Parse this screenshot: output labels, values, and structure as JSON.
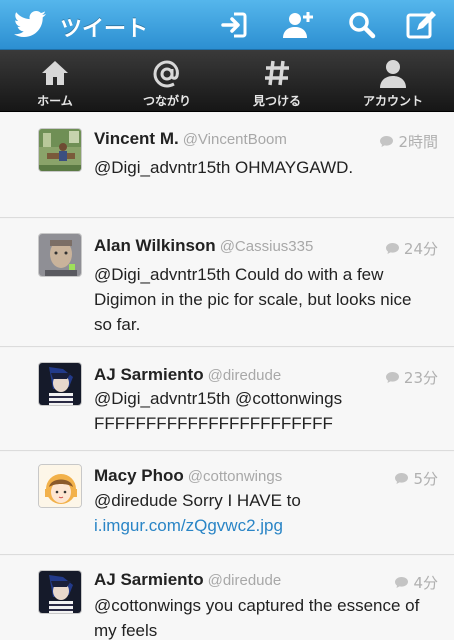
{
  "header": {
    "title": "ツイート",
    "colors": {
      "header_blue": "#2c8fd1",
      "tabbar_dark": "#1c1c1c"
    }
  },
  "tabs": [
    {
      "label": "ホーム",
      "icon": "home-icon"
    },
    {
      "label": "つながり",
      "icon": "at-icon"
    },
    {
      "label": "見つける",
      "icon": "hashtag-icon"
    },
    {
      "label": "アカウント",
      "icon": "person-icon"
    }
  ],
  "tweets": [
    {
      "name": "Vincent M.",
      "handle": "@VincentBoom",
      "time": "2時間",
      "text": "@Digi_advntr15th OHMAYGAWD.",
      "link": ""
    },
    {
      "name": "Alan Wilkinson",
      "handle": "@Cassius335",
      "time": "24分",
      "text": "@Digi_advntr15th Could do with a few Digimon in the pic for scale, but looks nice so far.",
      "link": ""
    },
    {
      "name": "AJ Sarmiento",
      "handle": "@diredude",
      "time": "23分",
      "text": "@Digi_advntr15th @cottonwings FFFFFFFFFFFFFFFFFFFFFFF",
      "link": ""
    },
    {
      "name": "Macy Phoo",
      "handle": "@cottonwings",
      "time": "5分",
      "text": "@diredude Sorry I HAVE to",
      "link": "i.imgur.com/zQgvwc2.jpg"
    },
    {
      "name": "AJ Sarmiento",
      "handle": "@diredude",
      "time": "4分",
      "text": "@cottonwings you captured the essence of my feels",
      "link": ""
    }
  ]
}
